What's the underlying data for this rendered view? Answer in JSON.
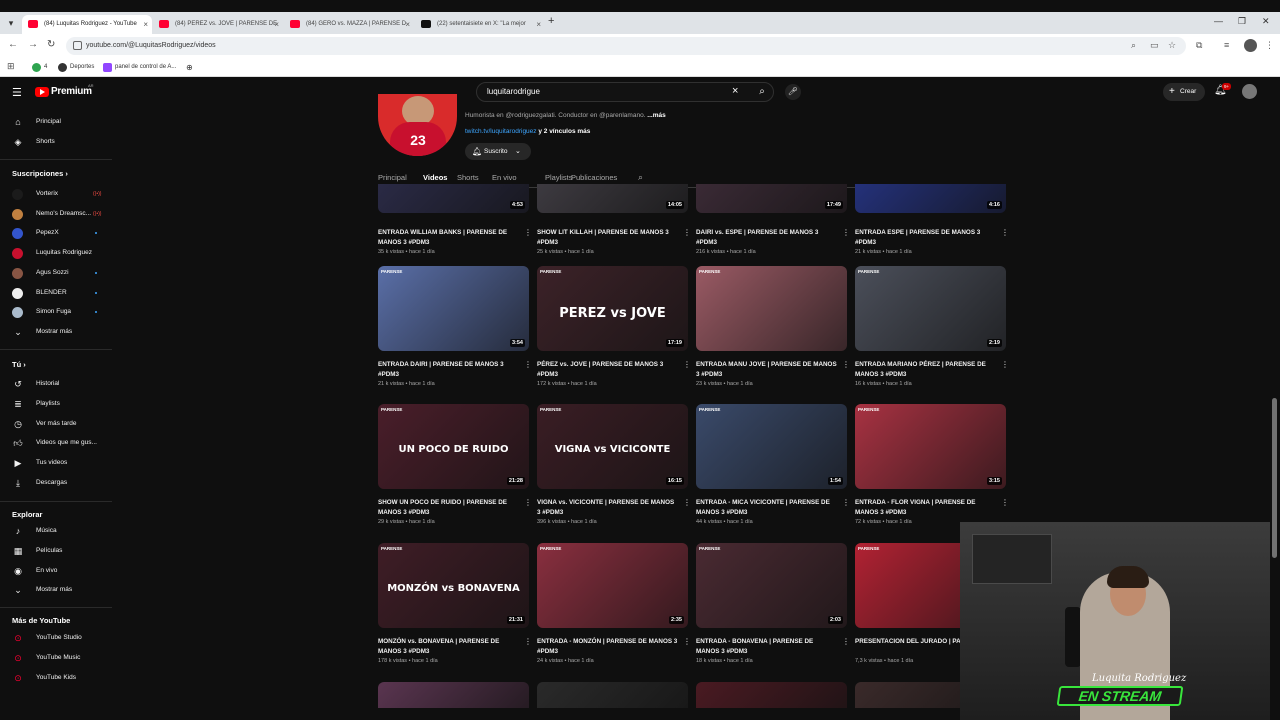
{
  "browser": {
    "tabs": [
      {
        "title": "(84) Luquitas Rodriguez - YouTube",
        "icon": "youtube-icon",
        "active": true
      },
      {
        "title": "(84) PEREZ vs. JOVE | PARENSE DE",
        "icon": "youtube-icon",
        "active": false
      },
      {
        "title": "(84) GERO vs. MAZZA | PARENSE D",
        "icon": "youtube-icon",
        "active": false
      },
      {
        "title": "(22) setentaisiete en X: \"La mejor",
        "icon": "x-icon",
        "active": false
      }
    ],
    "url": "youtube.com/@LuquitasRodriguez/videos",
    "bookmarks": [
      {
        "label": "4"
      },
      {
        "label": "Deportes"
      },
      {
        "label": "panel de control de A..."
      }
    ]
  },
  "yt": {
    "brand": "Premium",
    "region": "AR",
    "search_value": "luquitarodrigue",
    "create_label": "Crear",
    "notif_count": "9+"
  },
  "sidebar": {
    "main": [
      {
        "label": "Principal",
        "icon": "home-icon"
      },
      {
        "label": "Shorts",
        "icon": "shorts-icon"
      }
    ],
    "subs_title": "Suscripciones",
    "subs": [
      {
        "label": "Vorterix",
        "color": "#1b1b1b",
        "status": "live"
      },
      {
        "label": "Nemo's Dreamsc...",
        "color": "#c08040",
        "status": "live"
      },
      {
        "label": "PepezX",
        "color": "#3355cc",
        "status": "dot"
      },
      {
        "label": "Luquitas Rodriguez",
        "color": "#c8102e",
        "status": ""
      },
      {
        "label": "Agus Sozzi",
        "color": "#885544",
        "status": "dot"
      },
      {
        "label": "BLENDER",
        "color": "#eeeeee",
        "status": "dot"
      },
      {
        "label": "Simon Fuga",
        "color": "#aabbcc",
        "status": "dot"
      }
    ],
    "subs_more": "Mostrar más",
    "you_title": "Tú",
    "you": [
      {
        "label": "Historial",
        "icon": "history-icon"
      },
      {
        "label": "Playlists",
        "icon": "playlists-icon"
      },
      {
        "label": "Ver más tarde",
        "icon": "watch-later-icon"
      },
      {
        "label": "Videos que me gus...",
        "icon": "like-icon"
      },
      {
        "label": "Tus videos",
        "icon": "your-videos-icon"
      },
      {
        "label": "Descargas",
        "icon": "download-icon"
      }
    ],
    "explore_title": "Explorar",
    "explore": [
      {
        "label": "Música",
        "icon": "music-icon"
      },
      {
        "label": "Películas",
        "icon": "movies-icon"
      },
      {
        "label": "En vivo",
        "icon": "live-icon"
      }
    ],
    "explore_more": "Mostrar más",
    "more_title": "Más de YouTube",
    "more": [
      {
        "label": "YouTube Studio"
      },
      {
        "label": "YouTube Music"
      },
      {
        "label": "YouTube Kids"
      }
    ]
  },
  "channel": {
    "jersey_number": "23",
    "desc_prefix": "Humorista en @rodriguezgalati.  Conductor en @parenlamano. ",
    "desc_more": "...más",
    "link": "twitch.tv/luquitarodriguez",
    "link_more": " y 2 vínculos más",
    "subscribed_label": "Suscrito",
    "tabs": [
      "Principal",
      "Videos",
      "Shorts",
      "En vivo",
      "Playlists",
      "Publicaciones"
    ],
    "selected_tab": "Videos"
  },
  "videos": [
    {
      "title": "ENTRADA WILLIAM BANKS | PARENSE DE MANOS 3 #PDM3",
      "meta": "35 k vistas • hace 1 día",
      "duration": "4:53",
      "thumb_bg": "#2a2a45"
    },
    {
      "title": "SHOW LIT KILLAH | PARENSE DE MANOS 3 #PDM3",
      "meta": "25 k vistas • hace 1 día",
      "duration": "14:05",
      "thumb_bg": "#3d3a40"
    },
    {
      "title": "DAIRI vs. ESPE | PARENSE DE MANOS 3 #PDM3",
      "meta": "216 k vistas • hace 1 día",
      "duration": "17:49",
      "thumb_bg": "#3a2a35"
    },
    {
      "title": "ENTRADA ESPE | PARENSE DE MANOS 3 #PDM3",
      "meta": "21 k vistas • hace 1 día",
      "duration": "4:16",
      "thumb_bg": "#24317a"
    },
    {
      "title": "ENTRADA DAIRI | PARENSE DE MANOS 3 #PDM3",
      "meta": "21 k vistas • hace 1 día",
      "duration": "3:54",
      "thumb_bg": "#5a6fa8",
      "big": ""
    },
    {
      "title": "PÉREZ vs. JOVE | PARENSE DE MANOS 3 #PDM3",
      "meta": "172 k vistas • hace 1 día",
      "duration": "17:19",
      "thumb_bg": "#3c2228",
      "big": "PEREZ vs JOVE"
    },
    {
      "title": "ENTRADA MANU JOVE | PARENSE DE MANOS 3 #PDM3",
      "meta": "23 k vistas • hace 1 día",
      "duration": "",
      "thumb_bg": "#9a5a64",
      "big": ""
    },
    {
      "title": "ENTRADA MARIANO PÉREZ | PARENSE DE MANOS 3 #PDM3",
      "meta": "16 k vistas • hace 1 día",
      "duration": "2:19",
      "thumb_bg": "#4b4f5a",
      "big": ""
    },
    {
      "title": "SHOW UN POCO DE RUIDO | PARENSE DE MANOS 3 #PDM3",
      "meta": "29 k vistas • hace 1 día",
      "duration": "21:28",
      "thumb_bg": "#4a1e2a",
      "big": "UN POCO DE RUIDO"
    },
    {
      "title": "VIGNA vs. VICICONTE | PARENSE DE MANOS 3 #PDM3",
      "meta": "396 k vistas • hace 1 día",
      "duration": "16:15",
      "thumb_bg": "#3a1d24",
      "big": "VIGNA vs VICICONTE"
    },
    {
      "title": "ENTRADA - MICA VICICONTE | PARENSE DE MANOS 3 #PDM3",
      "meta": "44 k vistas • hace 1 día",
      "duration": "1:54",
      "thumb_bg": "#3a4a6a",
      "big": ""
    },
    {
      "title": "ENTRADA - FLOR VIGNA | PARENSE DE MANOS 3 #PDM3",
      "meta": "72 k vistas • hace 1 día",
      "duration": "3:15",
      "thumb_bg": "#a83242",
      "big": ""
    },
    {
      "title": "MONZÓN vs. BONAVENA | PARENSE DE MANOS 3 #PDM3",
      "meta": "178 k vistas • hace 1 día",
      "duration": "21:31",
      "thumb_bg": "#3f1d26",
      "big": "MONZÓN vs BONAVENA"
    },
    {
      "title": "ENTRADA - MONZÓN | PARENSE DE MANOS 3 #PDM3",
      "meta": "24 k vistas • hace 1 día",
      "duration": "2:35",
      "thumb_bg": "#8a2f3f",
      "big": ""
    },
    {
      "title": "ENTRADA - BONAVENA | PARENSE DE MANOS 3 #PDM3",
      "meta": "18 k vistas • hace 1 día",
      "duration": "2:03",
      "thumb_bg": "#4a2a32",
      "big": ""
    },
    {
      "title": "PRESENTACION DEL JURADO | PA",
      "meta": "7,3 k vistas • hace 1 día",
      "duration": "",
      "thumb_bg": "#b22233",
      "big": ""
    },
    {
      "title": "",
      "meta": "",
      "duration": "",
      "thumb_bg": "#5a3550"
    },
    {
      "title": "",
      "meta": "",
      "duration": "",
      "thumb_bg": "#2a2a2a"
    },
    {
      "title": "",
      "meta": "",
      "duration": "",
      "thumb_bg": "#4a1a22"
    },
    {
      "title": "",
      "meta": "",
      "duration": "",
      "thumb_bg": "#3a2a2a"
    }
  ],
  "thumb_brand": "PARENSE",
  "webcam": {
    "signature": "Luquita Rodriguez",
    "badge": "EN STREAM"
  }
}
